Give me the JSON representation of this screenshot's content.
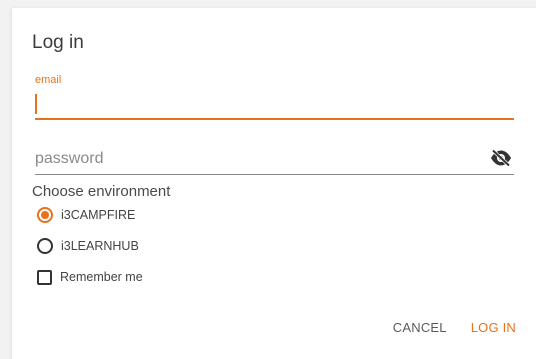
{
  "dialog": {
    "title": "Log in"
  },
  "email": {
    "label": "email",
    "value": ""
  },
  "password": {
    "placeholder": "password",
    "value": "",
    "toggle_icon": "eye-off-icon"
  },
  "environment": {
    "label": "Choose environment",
    "options": [
      {
        "label": "i3CAMPFIRE",
        "selected": true
      },
      {
        "label": "i3LEARNHUB",
        "selected": false
      }
    ]
  },
  "remember": {
    "label": "Remember me",
    "checked": false
  },
  "actions": {
    "cancel_label": "CANCEL",
    "login_label": "LOG IN"
  },
  "colors": {
    "accent": "#e8711e",
    "text": "#444444",
    "underline": "#8a8a8a"
  }
}
